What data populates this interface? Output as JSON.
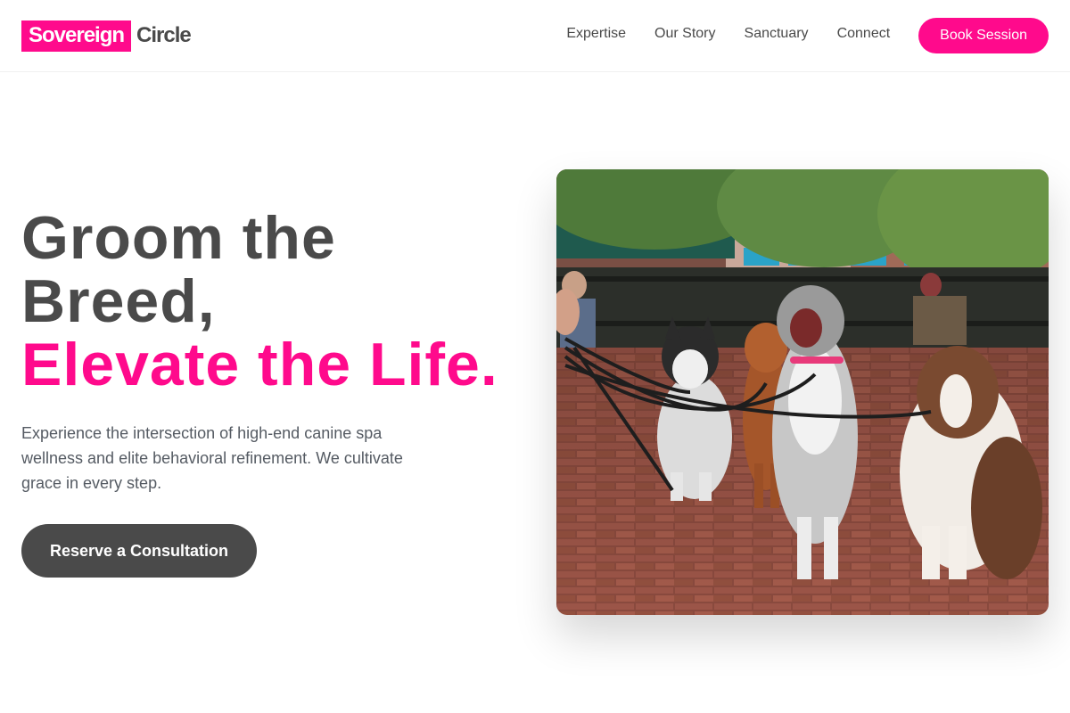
{
  "brand": {
    "highlight": "Sovereign",
    "rest": "Circle"
  },
  "nav": {
    "items": [
      {
        "label": "Expertise"
      },
      {
        "label": "Our Story"
      },
      {
        "label": "Sanctuary"
      },
      {
        "label": "Connect"
      }
    ],
    "cta_label": "Book Session"
  },
  "hero": {
    "title_line1": "Groom the",
    "title_line2": "Breed,",
    "title_accent": "Elevate the Life.",
    "description": "Experience the intersection of high-end canine spa wellness and elite behavioral refinement. We cultivate grace in every step.",
    "cta_label": "Reserve a Consultation",
    "image_subject": "dogs-on-leashes-in-park-photo"
  },
  "colors": {
    "accent": "#ff0a8c",
    "text_dark": "#4a4a4a",
    "text_muted": "#555b63"
  }
}
